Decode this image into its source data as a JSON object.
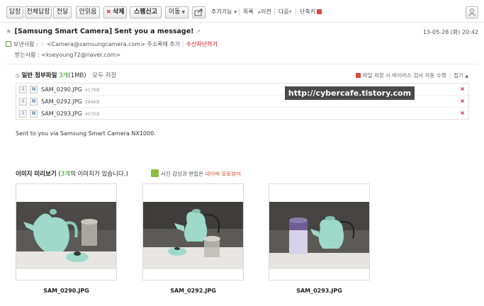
{
  "toolbar": {
    "reply": "답장",
    "reply_all": "전체답장",
    "forward": "전달",
    "safe_mail": "안읽음",
    "delete": "삭제",
    "spam": "스팸신고",
    "move": "이동",
    "more": "추가기능",
    "list": "목록",
    "prev": "이전",
    "next": "다음",
    "shortcut": "단축키"
  },
  "mail": {
    "subject": "[Samsung Smart Camera] Sent you a message!",
    "date": "13-05-28 (화) 20:42",
    "sender_label": "보낸사람 :",
    "sender": "<Camera@samsungcamera.com>",
    "add_contact": "주소록에 추가",
    "block": "수신차단하기",
    "recipient_label": "받는사람 :",
    "recipient": "<kseyoung72@naver.com>"
  },
  "attachments": {
    "label": "일반 첨부파일",
    "count": "3개",
    "total_size": "(1MB)",
    "save_all": "모두 저장",
    "scan_notice": "파일 저장 시 바이러스 검사 자동 수행",
    "collapse": "접기",
    "files": [
      {
        "name": "SAM_0290.JPG",
        "size": "417KB"
      },
      {
        "name": "SAM_0292.JPG",
        "size": "384KB"
      },
      {
        "name": "SAM_0293.JPG",
        "size": "407KB"
      }
    ]
  },
  "watermark": "http://cybercafe.tistory.com",
  "body_text": "Sent to you via Samsung Smart Camera NX1000.",
  "preview": {
    "title": "이미지 미리보기",
    "count_open": "(",
    "count": "3개",
    "count_rest": "의 이미지가 있습니다.)",
    "note": "사진 감상과 편집은",
    "note_link": "네이버 포토뷰어",
    "images": [
      {
        "name": "SAM_0290.JPG"
      },
      {
        "name": "SAM_0292.JPG"
      },
      {
        "name": "SAM_0293.JPG"
      }
    ]
  },
  "colors": {
    "accent_red": "#d0021b",
    "accent_green": "#2a9d0a",
    "teapot": "#9ed9c9"
  }
}
